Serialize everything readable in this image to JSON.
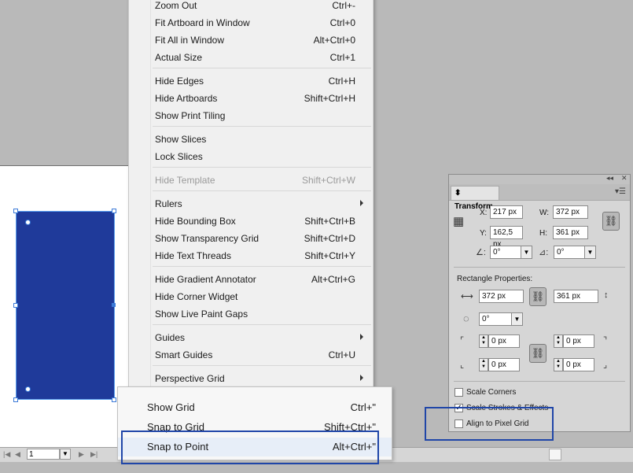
{
  "menu": {
    "items": [
      {
        "label": "Zoom Out",
        "shortcut": "Ctrl+-"
      },
      {
        "label": "Fit Artboard in Window",
        "shortcut": "Ctrl+0"
      },
      {
        "label": "Fit All in Window",
        "shortcut": "Alt+Ctrl+0"
      },
      {
        "label": "Actual Size",
        "shortcut": "Ctrl+1"
      },
      {
        "label": "Hide Edges",
        "shortcut": "Ctrl+H"
      },
      {
        "label": "Hide Artboards",
        "shortcut": "Shift+Ctrl+H"
      },
      {
        "label": "Show Print Tiling",
        "shortcut": ""
      },
      {
        "label": "Show Slices",
        "shortcut": ""
      },
      {
        "label": "Lock Slices",
        "shortcut": ""
      },
      {
        "label": "Hide Template",
        "shortcut": "Shift+Ctrl+W"
      },
      {
        "label": "Rulers",
        "shortcut": ""
      },
      {
        "label": "Hide Bounding Box",
        "shortcut": "Shift+Ctrl+B"
      },
      {
        "label": "Show Transparency Grid",
        "shortcut": "Shift+Ctrl+D"
      },
      {
        "label": "Hide Text Threads",
        "shortcut": "Shift+Ctrl+Y"
      },
      {
        "label": "Hide Gradient Annotator",
        "shortcut": "Alt+Ctrl+G"
      },
      {
        "label": "Hide Corner Widget",
        "shortcut": ""
      },
      {
        "label": "Show Live Paint Gaps",
        "shortcut": ""
      },
      {
        "label": "Guides",
        "shortcut": ""
      },
      {
        "label": "Smart Guides",
        "shortcut": "Ctrl+U"
      },
      {
        "label": "Perspective Grid",
        "shortcut": ""
      }
    ]
  },
  "submenu": {
    "items": [
      {
        "label": "Show Grid",
        "shortcut": "Ctrl+\""
      },
      {
        "label": "Snap to Grid",
        "shortcut": "Shift+Ctrl+\""
      },
      {
        "label": "Snap to Point",
        "shortcut": "Alt+Ctrl+\""
      }
    ]
  },
  "statusbar": {
    "page_value": "1"
  },
  "transform": {
    "tab_label": "Transform",
    "x_label": "X:",
    "x_value": "217 px",
    "y_label": "Y:",
    "y_value": "162,5 px",
    "w_label": "W:",
    "w_value": "372 px",
    "h_label": "H:",
    "h_value": "361 px",
    "rotate_value": "0°",
    "shear_value": "0°",
    "rect_props_label": "Rectangle Properties:",
    "rect_width": "372 px",
    "rect_height": "361 px",
    "corner_angle": "0°",
    "corner_tl": "0 px",
    "corner_tr": "0 px",
    "corner_bl": "0 px",
    "corner_br": "0 px",
    "scale_corners_label": "Scale Corners",
    "scale_strokes_label": "Scale Strokes & Effects",
    "align_pixel_label": "Align to Pixel Grid",
    "scale_corners_checked": false,
    "scale_strokes_checked": true,
    "align_pixel_checked": false
  },
  "colors": {
    "object_fill": "#1f3a9a",
    "annotation": "#2046a8"
  }
}
